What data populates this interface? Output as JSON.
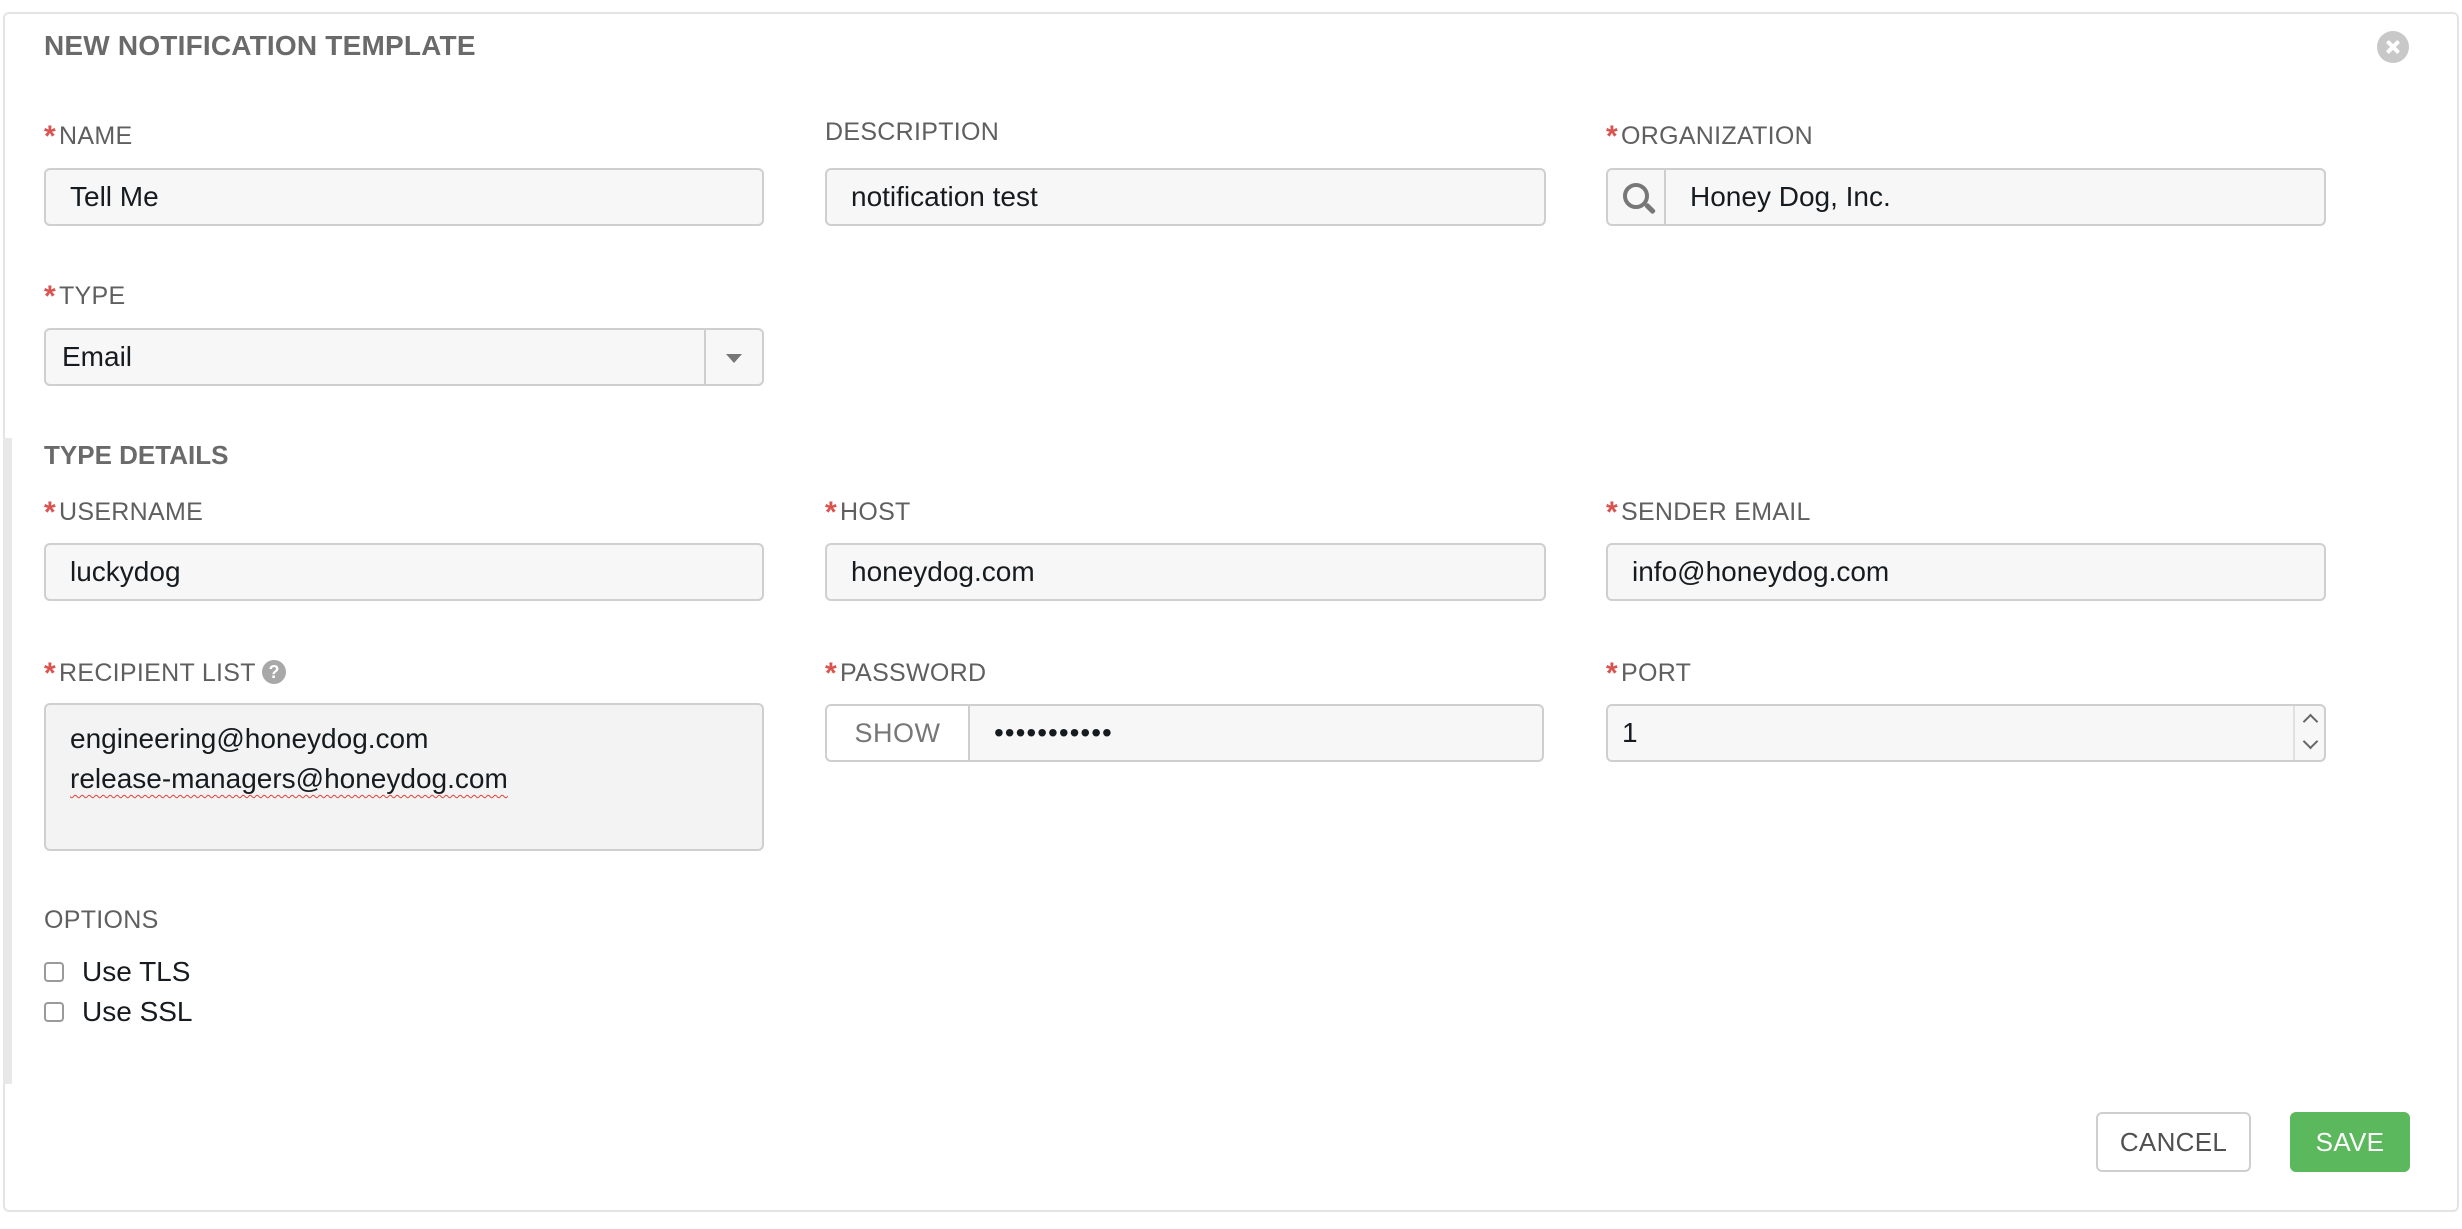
{
  "dialog": {
    "title": "NEW NOTIFICATION TEMPLATE",
    "close_icon": "close-icon"
  },
  "colors": {
    "required_marker": "#d9534f",
    "save_button": "#5cb85c",
    "input_background": "#f7f7f7",
    "border": "#cfcfcf"
  },
  "fields": {
    "required_marker": "*",
    "name": {
      "label": "NAME",
      "value": "Tell Me",
      "required": true
    },
    "description": {
      "label": "DESCRIPTION",
      "value": "notification test",
      "required": false
    },
    "organization": {
      "label": "ORGANIZATION",
      "value": "Honey Dog, Inc.",
      "required": true,
      "lookup_icon": "search-icon"
    },
    "type": {
      "label": "TYPE",
      "value": "Email",
      "required": true,
      "caret_icon": "caret-down-icon"
    }
  },
  "type_details": {
    "section_title": "TYPE DETAILS",
    "username": {
      "label": "USERNAME",
      "value": "luckydog",
      "required": true
    },
    "host": {
      "label": "HOST",
      "value": "honeydog.com",
      "required": true
    },
    "sender_email": {
      "label": "SENDER EMAIL",
      "value": "info@honeydog.com",
      "required": true
    },
    "recipient_list": {
      "label": "RECIPIENT LIST",
      "required": true,
      "help_icon": "question-circle-icon",
      "lines": [
        "engineering@honeydog.com",
        "release-managers@honeydog.com"
      ]
    },
    "password": {
      "label": "PASSWORD",
      "required": true,
      "show_label": "SHOW",
      "masked_value": "•••••••••••"
    },
    "port": {
      "label": "PORT",
      "value": "1",
      "required": true
    }
  },
  "options": {
    "label": "OPTIONS",
    "items": [
      {
        "label": "Use TLS",
        "checked": false
      },
      {
        "label": "Use SSL",
        "checked": false
      }
    ]
  },
  "actions": {
    "cancel_label": "CANCEL",
    "save_label": "SAVE"
  }
}
